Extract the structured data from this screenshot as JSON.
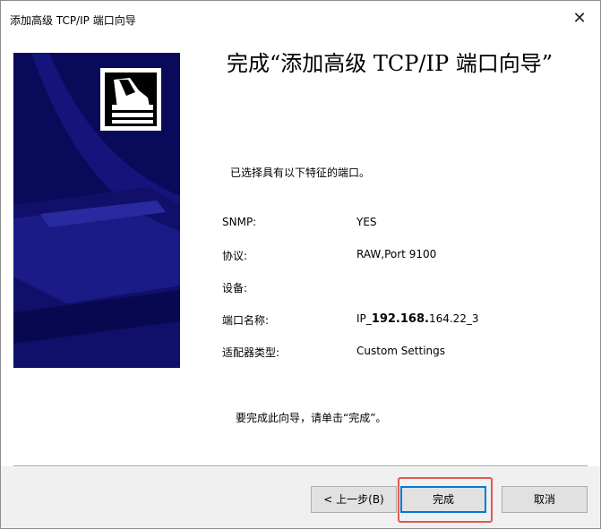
{
  "window": {
    "title": "添加高级 TCP/IP 端口向导",
    "close_glyph": "✕"
  },
  "main": {
    "heading": "完成“添加高级 TCP/IP 端口向导”",
    "intro": "已选择具有以下特征的端口。",
    "details": [
      {
        "label": "SNMP:",
        "value": "YES"
      },
      {
        "label": "协议:",
        "value": "RAW,Port 9100"
      },
      {
        "label": "设备:",
        "value": ""
      },
      {
        "label": "端口名称:",
        "value_prefix": "IP_",
        "value_bold": "192.168.",
        "value_suffix": "164.22_3"
      },
      {
        "label": "适配器类型:",
        "value": "Custom Settings"
      }
    ],
    "finish_note": "要完成此向导，请单击“完成”。"
  },
  "buttons": {
    "back": "< 上一步(B)",
    "finish": "完成",
    "cancel": "取消"
  },
  "colors": {
    "banner_background": "#0a0a5a",
    "highlight_border": "#e05a4f",
    "default_button_border": "#0078d7"
  },
  "icons": {
    "banner": "wizard-printer-banner",
    "logo": "printer-icon"
  }
}
